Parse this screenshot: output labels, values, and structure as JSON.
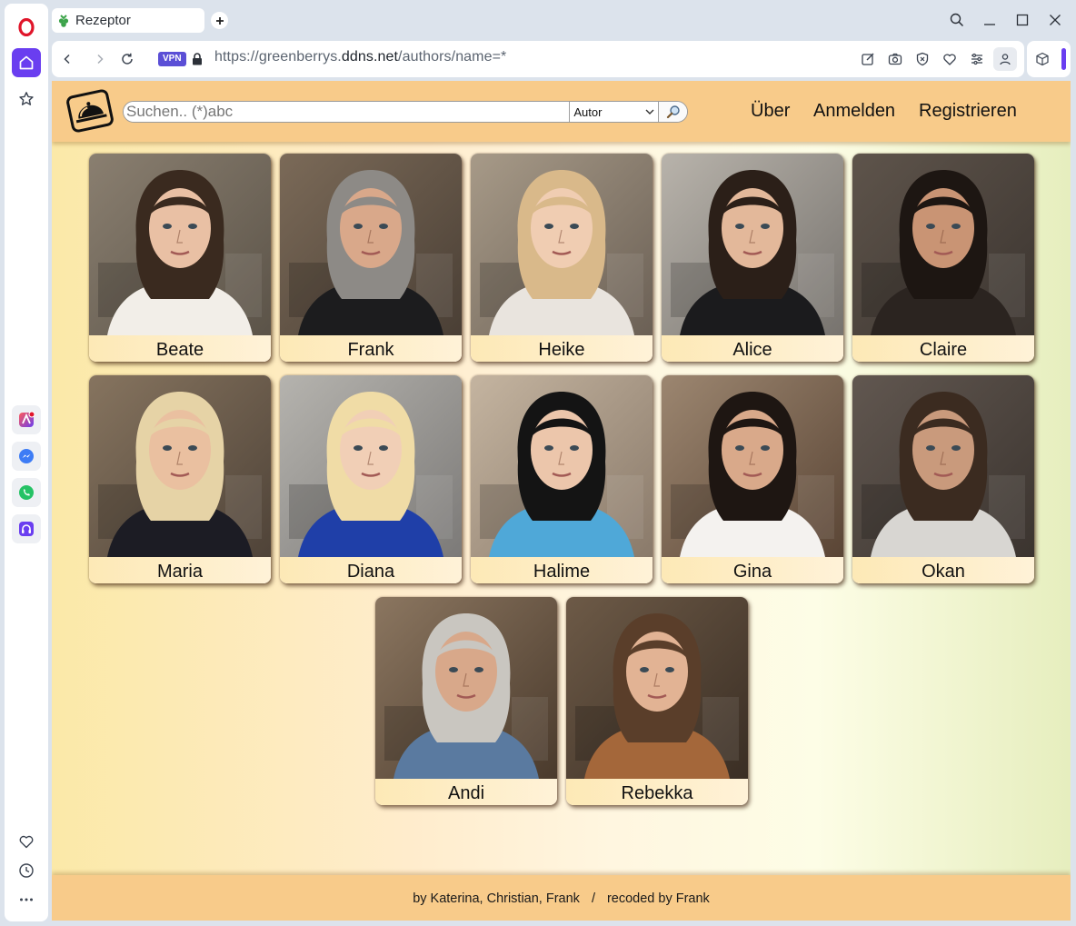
{
  "browser": {
    "tab_title": "Rezeptor",
    "vpn_label": "VPN",
    "url_prefix": "https://greenberrys.",
    "url_domain": "ddns.net",
    "url_path": "/authors/name=*",
    "accent_color": "#5b4fd6"
  },
  "header": {
    "search_placeholder": "Suchen.. (*)abc",
    "search_type": "Autor",
    "nav": [
      "Über",
      "Anmelden",
      "Registrieren"
    ]
  },
  "authors": [
    {
      "name": "Beate",
      "photo": "woman-dark-hair-portrait"
    },
    {
      "name": "Frank",
      "photo": "man-grey-hair-tshirt-portrait"
    },
    {
      "name": "Heike",
      "photo": "woman-blonde-portrait"
    },
    {
      "name": "Alice",
      "photo": "woman-dark-hair-jacket-portrait"
    },
    {
      "name": "Claire",
      "photo": "woman-dark-hair-blue-eyes-portrait"
    },
    {
      "name": "Maria",
      "photo": "woman-blonde-curly-portrait"
    },
    {
      "name": "Diana",
      "photo": "woman-blonde-blue-tshirt-portrait"
    },
    {
      "name": "Halime",
      "photo": "woman-black-curly-portrait"
    },
    {
      "name": "Gina",
      "photo": "woman-cooking-portrait"
    },
    {
      "name": "Okan",
      "photo": "man-brown-hair-portrait"
    },
    {
      "name": "Andi",
      "photo": "man-grey-beard-apron-portrait"
    },
    {
      "name": "Rebekka",
      "photo": "woman-bangs-portrait"
    }
  ],
  "footer": {
    "credits": "by Katerina, Christian, Frank",
    "separator": "/",
    "recoded": "recoded by Frank"
  }
}
